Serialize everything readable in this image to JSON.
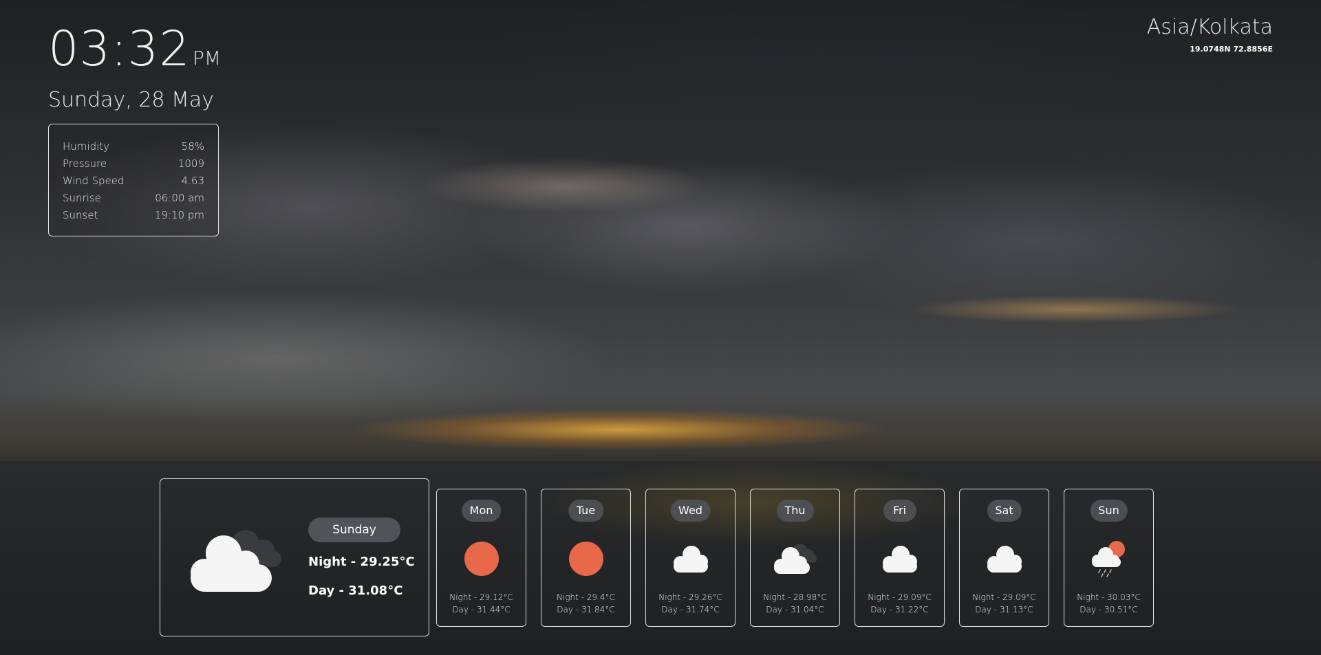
{
  "clock": {
    "time": "03:32",
    "ampm": "PM",
    "date": "Sunday, 28 May"
  },
  "location": {
    "timezone": "Asia/Kolkata",
    "coords": "19.0748N 72.8856E"
  },
  "details": [
    {
      "label": "Humidity",
      "value": "58%"
    },
    {
      "label": "Pressure",
      "value": "1009"
    },
    {
      "label": "Wind Speed",
      "value": "4.63"
    },
    {
      "label": "Sunrise",
      "value": "06:00 am"
    },
    {
      "label": "Sunset",
      "value": "19:10 pm"
    }
  ],
  "today": {
    "day": "Sunday",
    "night": "Night - 29.25°C",
    "day_temp": "Day - 31.08°C",
    "icon": "cloudy-icon"
  },
  "forecast": [
    {
      "day": "Mon",
      "icon": "sun-icon",
      "night": "Night - 29.12°C",
      "day_temp": "Day - 31.44°C"
    },
    {
      "day": "Tue",
      "icon": "sun-icon",
      "night": "Night - 29.4°C",
      "day_temp": "Day - 31.84°C"
    },
    {
      "day": "Wed",
      "icon": "cloud-icon",
      "night": "Night - 29.26°C",
      "day_temp": "Day - 31.74°C"
    },
    {
      "day": "Thu",
      "icon": "cloudy-icon",
      "night": "Night - 28.98°C",
      "day_temp": "Day - 31.04°C"
    },
    {
      "day": "Fri",
      "icon": "cloud-icon",
      "night": "Night - 29.09°C",
      "day_temp": "Day - 31.22°C"
    },
    {
      "day": "Sat",
      "icon": "cloud-icon",
      "night": "Night - 29.09°C",
      "day_temp": "Day - 31.13°C"
    },
    {
      "day": "Sun",
      "icon": "rain-sun-icon",
      "night": "Night - 30.03°C",
      "day_temp": "Day - 30.51°C"
    }
  ],
  "colors": {
    "sun": "#e8684a",
    "cloud": "#f5f5f5",
    "cloud_dark": "#3a3b3e",
    "pill": "#505256"
  }
}
